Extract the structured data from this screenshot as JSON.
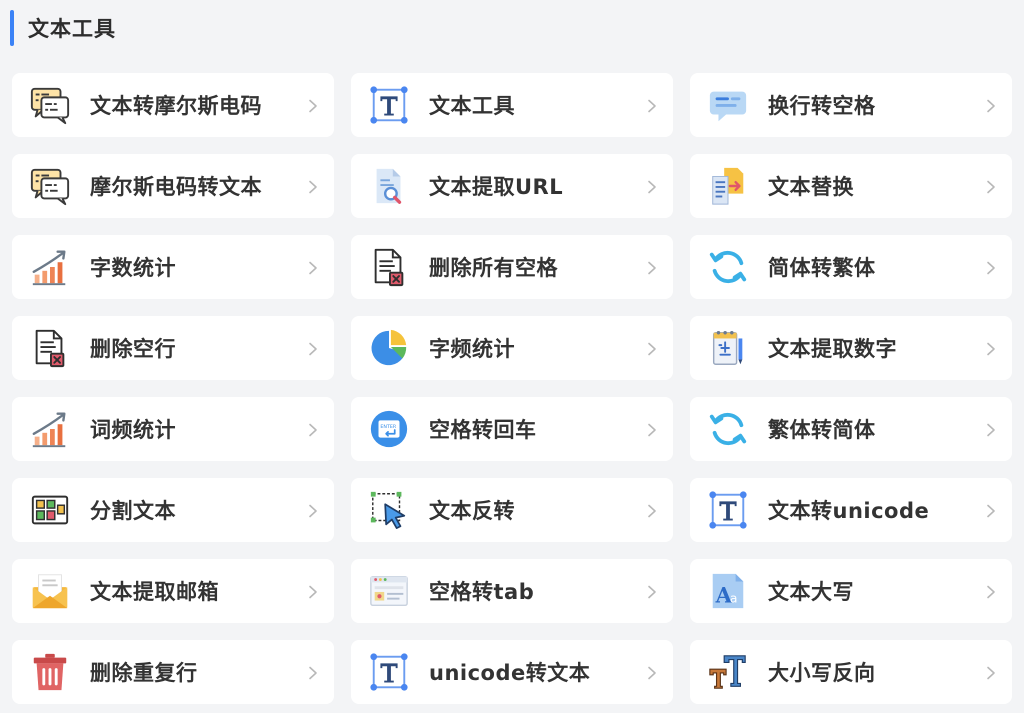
{
  "section": {
    "title": "文本工具",
    "accent_color": "#3b82f6"
  },
  "tools": [
    {
      "label": "文本转摩尔斯电码",
      "icon": "morse-chat-icon"
    },
    {
      "label": "文本工具",
      "icon": "text-t-icon"
    },
    {
      "label": "换行转空格",
      "icon": "message-lines-icon"
    },
    {
      "label": "摩尔斯电码转文本",
      "icon": "morse-chat-icon"
    },
    {
      "label": "文本提取URL",
      "icon": "document-search-icon"
    },
    {
      "label": "文本替换",
      "icon": "document-replace-icon"
    },
    {
      "label": "字数统计",
      "icon": "bar-chart-growth-icon"
    },
    {
      "label": "删除所有空格",
      "icon": "document-delete-icon"
    },
    {
      "label": "简体转繁体",
      "icon": "refresh-cycle-icon"
    },
    {
      "label": "删除空行",
      "icon": "document-delete-icon"
    },
    {
      "label": "字频统计",
      "icon": "pie-chart-icon"
    },
    {
      "label": "文本提取数字",
      "icon": "notepad-pen-icon"
    },
    {
      "label": "词频统计",
      "icon": "bar-chart-growth-icon"
    },
    {
      "label": "空格转回车",
      "icon": "enter-key-icon"
    },
    {
      "label": "繁体转简体",
      "icon": "refresh-cycle-icon"
    },
    {
      "label": "分割文本",
      "icon": "split-blocks-icon"
    },
    {
      "label": "文本反转",
      "icon": "cursor-selection-icon"
    },
    {
      "label": "文本转unicode",
      "icon": "text-t-icon"
    },
    {
      "label": "文本提取邮箱",
      "icon": "envelope-letter-icon"
    },
    {
      "label": "空格转tab",
      "icon": "browser-window-icon"
    },
    {
      "label": "文本大写",
      "icon": "font-aa-icon"
    },
    {
      "label": "删除重复行",
      "icon": "trash-bin-icon"
    },
    {
      "label": "unicode转文本",
      "icon": "text-t-icon"
    },
    {
      "label": "大小写反向",
      "icon": "font-tt-icon"
    }
  ]
}
